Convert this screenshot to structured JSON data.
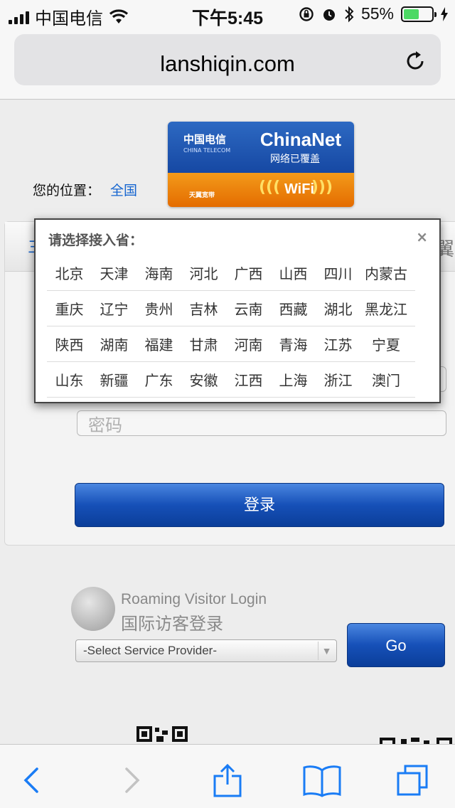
{
  "status_bar": {
    "carrier": "中国电信",
    "time": "下午5:45",
    "battery_percent": "55%",
    "battery_level": 0.55,
    "battery_color": "#4cd964"
  },
  "browser": {
    "url": "lanshiqin.com",
    "reload_icon": "reload-icon"
  },
  "location": {
    "label": "您的位置：",
    "value": "全国"
  },
  "banner": {
    "brand": "ChinaNet",
    "tagline": "网络已覆盖",
    "wifi": "WiFi",
    "logo_text": "中国电信",
    "logo_sub": "CHINA TELECOM",
    "tianyi": "天翼宽带"
  },
  "login_card": {
    "tab_left": "三",
    "tab_right": "翼",
    "password_placeholder": "密码",
    "login_label": "登录"
  },
  "province_popup": {
    "title": "请选择接入省：",
    "close": "×",
    "rows": [
      [
        "北京",
        "天津",
        "海南",
        "河北",
        "广西",
        "山西",
        "四川",
        "内蒙古"
      ],
      [
        "重庆",
        "辽宁",
        "贵州",
        "吉林",
        "云南",
        "西藏",
        "湖北",
        "黑龙江"
      ],
      [
        "陕西",
        "湖南",
        "福建",
        "甘肃",
        "河南",
        "青海",
        "江苏",
        "宁夏"
      ],
      [
        "山东",
        "新疆",
        "广东",
        "安徽",
        "江西",
        "上海",
        "浙江",
        "澳门"
      ]
    ]
  },
  "roaming": {
    "title_en": "Roaming Visitor Login",
    "title_cn": "国际访客登录",
    "select_value": "-Select Service Provider-",
    "go_label": "Go"
  },
  "accent_color": "#1565d0"
}
